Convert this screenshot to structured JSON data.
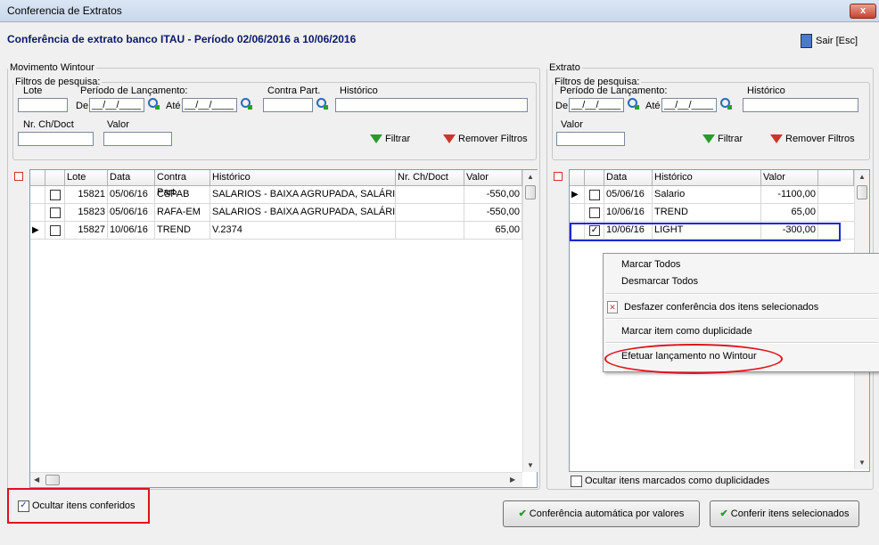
{
  "window": {
    "title": "Conferencia de Extratos",
    "close": "x"
  },
  "header": {
    "title": "Conferência de extrato banco ITAU - Período 02/06/2016 a 10/06/2016",
    "exit_label": "Sair [Esc]"
  },
  "left": {
    "group": "Movimento Wintour",
    "filters": {
      "legend": "Filtros de pesquisa:",
      "lote": "Lote",
      "periodo": "Período de Lançamento:",
      "de": "De",
      "ate": "Até",
      "date_mask": "__/__/____",
      "contra": "Contra Part.",
      "historico": "Histórico",
      "nr": "Nr. Ch/Doct",
      "valor": "Valor",
      "filtrar": "Filtrar",
      "remover": "Remover Filtros"
    },
    "columns": [
      "Lote",
      "Data",
      "Contra Part.",
      "Histórico",
      "Nr. Ch/Doct",
      "Valor"
    ],
    "rows": [
      {
        "lote": "15821",
        "data": "05/06/16",
        "contra": "CSPAB",
        "hist": "SALARIOS - BAIXA AGRUPADA, SALÁRIO",
        "nr": "",
        "valor": "-550,00"
      },
      {
        "lote": "15823",
        "data": "05/06/16",
        "contra": "RAFA-EM",
        "hist": "SALARIOS - BAIXA AGRUPADA, SALÁRIO",
        "nr": "",
        "valor": "-550,00"
      },
      {
        "lote": "15827",
        "data": "10/06/16",
        "contra": "TREND",
        "hist": "V.2374",
        "nr": "",
        "valor": "65,00"
      }
    ],
    "hide_checked": "Ocultar itens conferidos"
  },
  "right": {
    "group": "Extrato",
    "filters": {
      "legend": "Filtros de pesquisa:",
      "periodo": "Período de Lançamento:",
      "de": "De",
      "ate": "Até",
      "date_mask": "__/__/____",
      "historico": "Histórico",
      "valor": "Valor",
      "filtrar": "Filtrar",
      "remover": "Remover Filtros"
    },
    "columns": [
      "Data",
      "Histórico",
      "Valor"
    ],
    "rows": [
      {
        "data": "05/06/16",
        "hist": "Salario",
        "valor": "-1100,00"
      },
      {
        "data": "10/06/16",
        "hist": "TREND",
        "valor": "65,00"
      },
      {
        "data": "10/06/16",
        "hist": "LIGHT",
        "valor": "-300,00"
      }
    ],
    "hide_dup": "Ocultar itens marcados como duplicidades"
  },
  "menu": {
    "items": [
      "Marcar Todos",
      "Desmarcar Todos",
      "Desfazer conferência dos itens selecionados",
      "Marcar item como duplicidade",
      "Efetuar lançamento no Wintour"
    ]
  },
  "buttons": {
    "auto": "Conferência automática por valores",
    "conferir": "Conferir itens selecionados"
  }
}
